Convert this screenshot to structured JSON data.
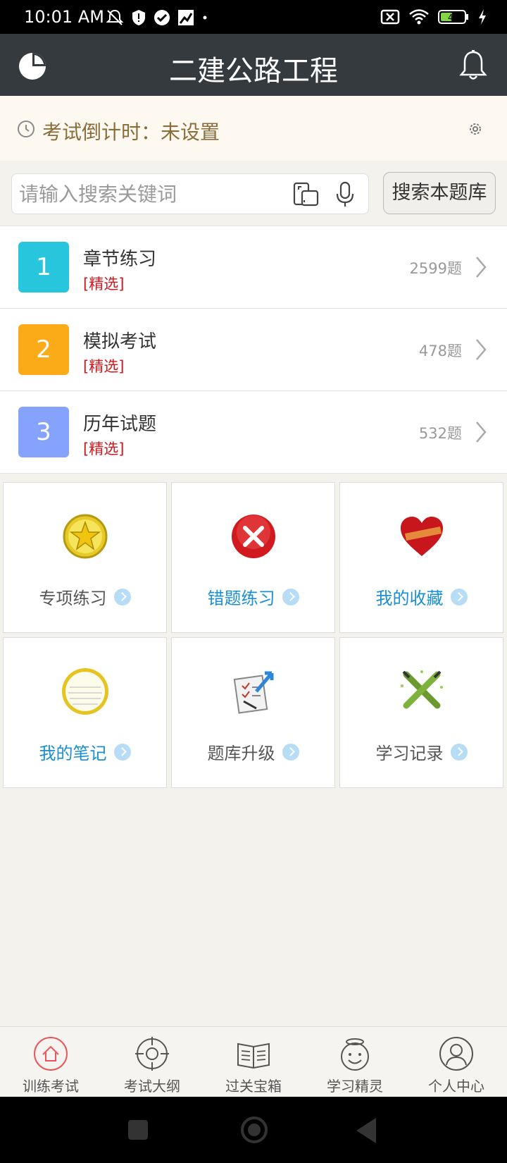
{
  "status_bar": {
    "time": "10:01 AM",
    "battery": "47"
  },
  "header": {
    "title": "二建公路工程",
    "left_icon": "pie-chart-icon",
    "right_icon": "bell-icon"
  },
  "countdown": {
    "label": "考试倒计时：未设置"
  },
  "search": {
    "placeholder": "请输入搜索关键词",
    "button_label": "搜索本题库"
  },
  "list": [
    {
      "num": "1",
      "name": "章节练习",
      "tag": "[精选]",
      "count": "2599题",
      "color": "#28c6dc"
    },
    {
      "num": "2",
      "name": "模拟考试",
      "tag": "[精选]",
      "count": "478题",
      "color": "#fbab17"
    },
    {
      "num": "3",
      "name": "历年试题",
      "tag": "[精选]",
      "count": "532题",
      "color": "#85a3fc"
    }
  ],
  "grid": [
    {
      "label": "专项练习",
      "icon": "star-badge-icon"
    },
    {
      "label": "错题练习",
      "icon": "red-x-icon"
    },
    {
      "label": "我的收藏",
      "icon": "heart-favorite-icon"
    },
    {
      "label": "我的笔记",
      "icon": "notepad-icon"
    },
    {
      "label": "题库升级",
      "icon": "checklist-upgrade-icon"
    },
    {
      "label": "学习记录",
      "icon": "pencils-record-icon"
    }
  ],
  "bottom_nav": [
    {
      "label": "训练考试",
      "icon": "home-icon"
    },
    {
      "label": "考试大纲",
      "icon": "target-icon"
    },
    {
      "label": "过关宝箱",
      "icon": "newspaper-icon"
    },
    {
      "label": "学习精灵",
      "icon": "smiley-angel-icon"
    },
    {
      "label": "个人中心",
      "icon": "user-icon"
    }
  ]
}
